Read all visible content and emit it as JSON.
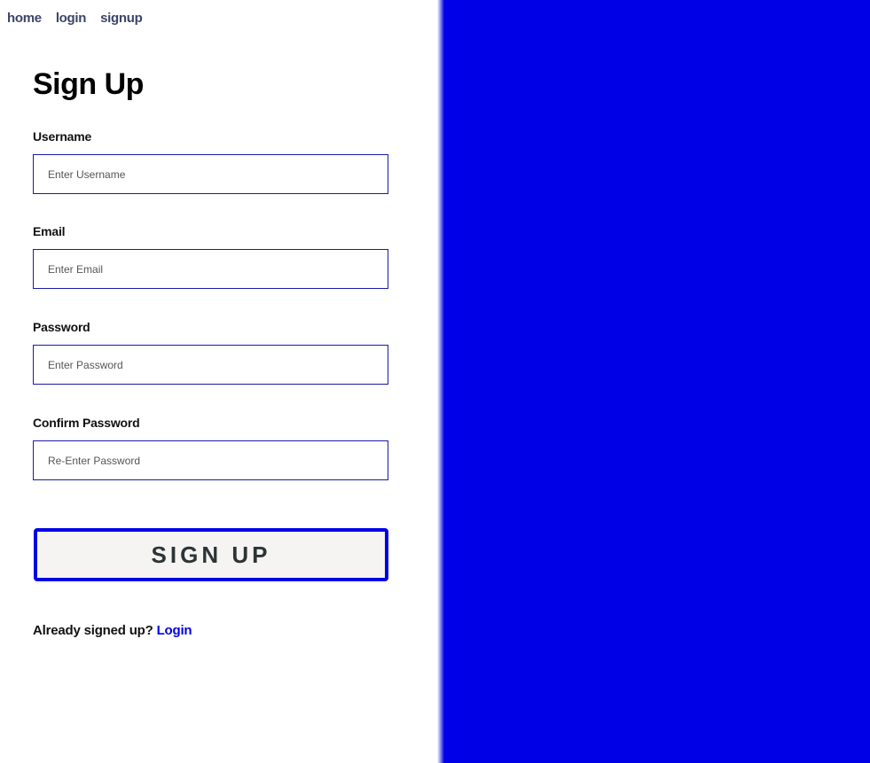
{
  "nav": {
    "items": [
      "home",
      "login",
      "signup"
    ]
  },
  "form": {
    "title": "Sign Up",
    "fields": [
      {
        "label": "Username",
        "placeholder": "Enter Username",
        "value": ""
      },
      {
        "label": "Email",
        "placeholder": "Enter Email",
        "value": ""
      },
      {
        "label": "Password",
        "placeholder": "Enter Password",
        "value": ""
      },
      {
        "label": "Confirm Password",
        "placeholder": "Re-Enter Password",
        "value": ""
      }
    ],
    "submit_label": "SIGN UP",
    "already_text": "Already signed up?",
    "login_link": "Login"
  },
  "colors": {
    "accent": "#0000e6",
    "nav": "#3d4468"
  }
}
